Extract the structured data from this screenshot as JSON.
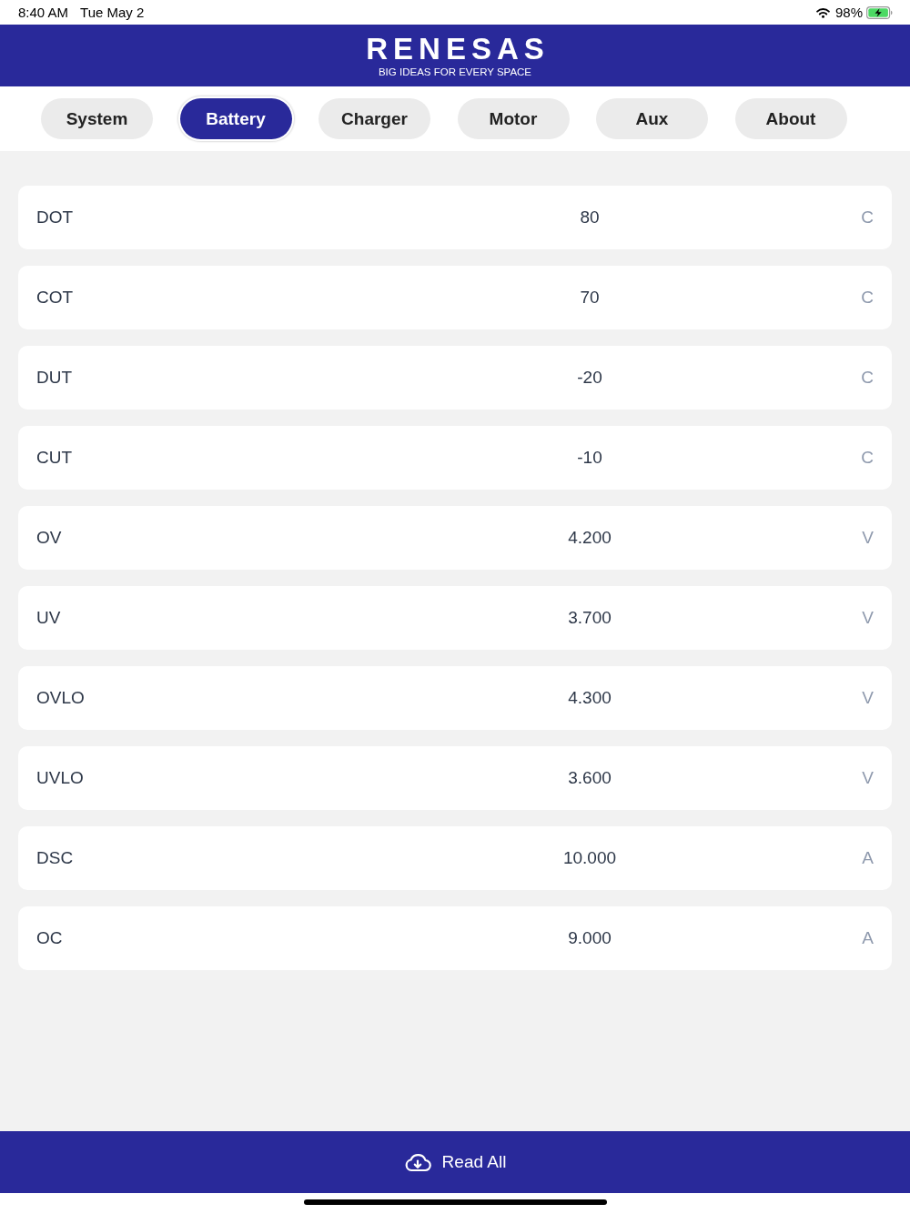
{
  "status_bar": {
    "time": "8:40 AM",
    "date": "Tue May 2",
    "battery_percent": "98%",
    "charging": true
  },
  "header": {
    "logo": "RENESAS",
    "tagline": "BIG IDEAS FOR EVERY SPACE"
  },
  "tabs": [
    {
      "label": "System",
      "selected": false
    },
    {
      "label": "Battery",
      "selected": true
    },
    {
      "label": "Charger",
      "selected": false
    },
    {
      "label": "Motor",
      "selected": false
    },
    {
      "label": "Aux",
      "selected": false
    },
    {
      "label": "About",
      "selected": false
    }
  ],
  "parameters": [
    {
      "name": "DOT",
      "value": "80",
      "unit": "C"
    },
    {
      "name": "COT",
      "value": "70",
      "unit": "C"
    },
    {
      "name": "DUT",
      "value": "-20",
      "unit": "C"
    },
    {
      "name": "CUT",
      "value": "-10",
      "unit": "C"
    },
    {
      "name": "OV",
      "value": "4.200",
      "unit": "V"
    },
    {
      "name": "UV",
      "value": "3.700",
      "unit": "V"
    },
    {
      "name": "OVLO",
      "value": "4.300",
      "unit": "V"
    },
    {
      "name": "UVLO",
      "value": "3.600",
      "unit": "V"
    },
    {
      "name": "DSC",
      "value": "10.000",
      "unit": "A"
    },
    {
      "name": "OC",
      "value": "9.000",
      "unit": "A"
    }
  ],
  "action_button": {
    "label": "Read All"
  }
}
